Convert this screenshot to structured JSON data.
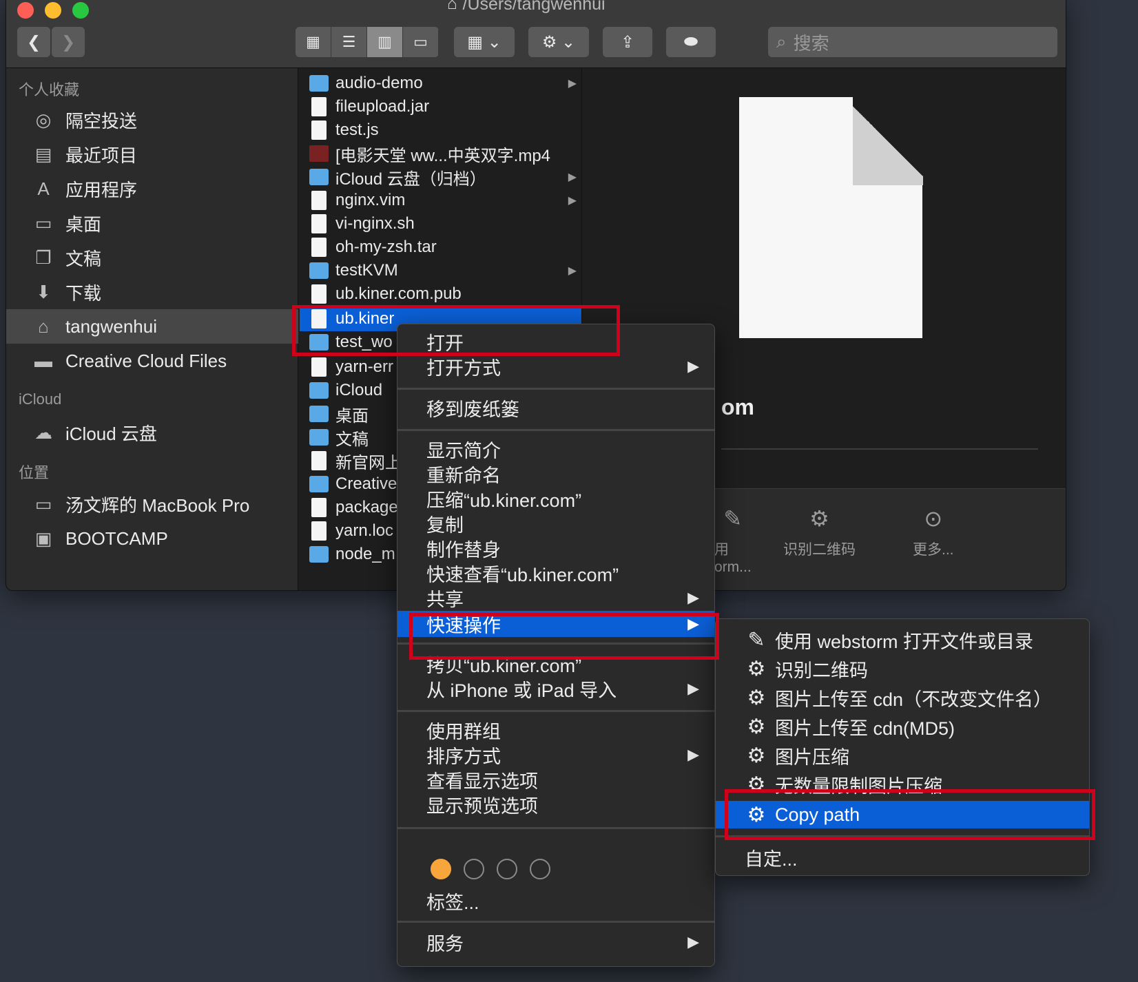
{
  "window": {
    "title": "/Users/tangwenhui",
    "search_placeholder": "搜索"
  },
  "sidebar": {
    "favorites_header": "个人收藏",
    "favorites": [
      {
        "label": "隔空投送",
        "icon": "airdrop-icon"
      },
      {
        "label": "最近项目",
        "icon": "recents-icon"
      },
      {
        "label": "应用程序",
        "icon": "applications-icon"
      },
      {
        "label": "桌面",
        "icon": "desktop-icon"
      },
      {
        "label": "文稿",
        "icon": "documents-icon"
      },
      {
        "label": "下载",
        "icon": "downloads-icon"
      },
      {
        "label": "tangwenhui",
        "icon": "home-icon"
      },
      {
        "label": "Creative Cloud Files",
        "icon": "folder-icon"
      }
    ],
    "icloud_header": "iCloud",
    "icloud": [
      {
        "label": "iCloud 云盘",
        "icon": "cloud-icon"
      }
    ],
    "locations_header": "位置",
    "locations": [
      {
        "label": "汤文辉的 MacBook Pro",
        "icon": "laptop-icon"
      },
      {
        "label": "BOOTCAMP",
        "icon": "disk-icon"
      }
    ]
  },
  "files": [
    {
      "name": "audio-demo",
      "type": "folder",
      "has_children": true
    },
    {
      "name": "fileupload.jar",
      "type": "doc"
    },
    {
      "name": "test.js",
      "type": "doc"
    },
    {
      "name": "[电影天堂 ww...中英双字.mp4",
      "type": "video"
    },
    {
      "name": "iCloud 云盘（归档）",
      "type": "folder",
      "has_children": true
    },
    {
      "name": "nginx.vim",
      "type": "doc",
      "has_children": true
    },
    {
      "name": "vi-nginx.sh",
      "type": "doc"
    },
    {
      "name": "oh-my-zsh.tar",
      "type": "doc"
    },
    {
      "name": "testKVM",
      "type": "folder",
      "has_children": true
    },
    {
      "name": "ub.kiner.com.pub",
      "type": "doc"
    },
    {
      "name": "ub.kiner",
      "type": "doc",
      "selected": true
    },
    {
      "name": "test_wo",
      "type": "folder"
    },
    {
      "name": "yarn-err",
      "type": "doc"
    },
    {
      "name": "iCloud",
      "type": "folder"
    },
    {
      "name": "桌面",
      "type": "folder"
    },
    {
      "name": "文稿",
      "type": "folder"
    },
    {
      "name": "新官网上",
      "type": "doc"
    },
    {
      "name": "Creative",
      "type": "folder"
    },
    {
      "name": "package",
      "type": "doc"
    },
    {
      "name": "yarn.loc",
      "type": "doc"
    },
    {
      "name": "node_m",
      "type": "folder"
    }
  ],
  "preview": {
    "name_fragment": "om",
    "actions": [
      {
        "label": "用\norm...",
        "icon": "edit-icon"
      },
      {
        "label": "识别二维码",
        "icon": "gear-icon"
      },
      {
        "label": "更多...",
        "icon": "more-icon"
      }
    ]
  },
  "context_menu": {
    "items": [
      {
        "label": "打开"
      },
      {
        "label": "打开方式",
        "submenu": true
      },
      {
        "label": "移到废纸篓"
      },
      {
        "label": "显示简介"
      },
      {
        "label": "重新命名"
      },
      {
        "label": "压缩“ub.kiner.com”"
      },
      {
        "label": "复制"
      },
      {
        "label": "制作替身"
      },
      {
        "label": "快速查看“ub.kiner.com”"
      },
      {
        "label": "共享",
        "submenu": true
      },
      {
        "label": "快速操作",
        "submenu": true,
        "highlighted": true
      },
      {
        "label": "拷贝“ub.kiner.com”"
      },
      {
        "label": "从 iPhone 或 iPad 导入",
        "submenu": true
      },
      {
        "label": "使用群组"
      },
      {
        "label": "排序方式",
        "submenu": true
      },
      {
        "label": "查看显示选项"
      },
      {
        "label": "显示预览选项"
      },
      {
        "label": "标签..."
      },
      {
        "label": "服务",
        "submenu": true
      }
    ],
    "tag_colors": [
      "#f8a53b",
      "",
      "",
      ""
    ]
  },
  "quick_actions_submenu": {
    "items": [
      {
        "label": "使用 webstorm 打开文件或目录",
        "icon": "edit-icon"
      },
      {
        "label": "识别二维码",
        "icon": "gear-icon"
      },
      {
        "label": "图片上传至 cdn（不改变文件名）",
        "icon": "gear-icon"
      },
      {
        "label": "图片上传至 cdn(MD5)",
        "icon": "gear-icon"
      },
      {
        "label": "图片压缩",
        "icon": "gear-icon"
      },
      {
        "label": "无数量限制图片压缩",
        "icon": "gear-icon"
      },
      {
        "label": "Copy path",
        "icon": "gear-icon",
        "highlighted": true
      },
      {
        "label": "自定..."
      }
    ]
  },
  "colors": {
    "selection": "#0b5fd6",
    "annotation": "#d0021b",
    "folder": "#58a9e6"
  }
}
